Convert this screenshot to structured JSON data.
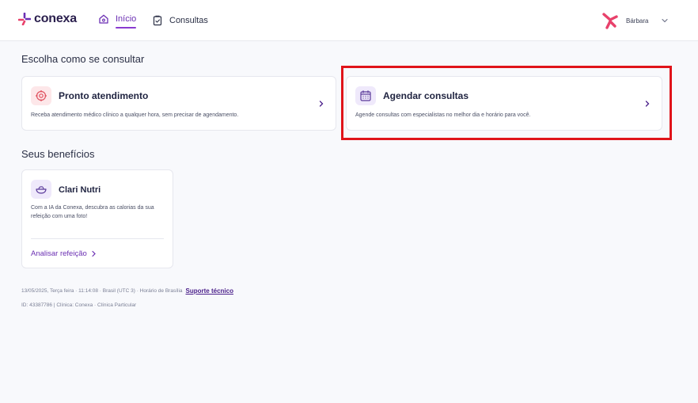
{
  "brand": {
    "name": "conexa",
    "accent": "#8a3ad0",
    "logo_colors": [
      "#e8416b",
      "#6b2fb3"
    ]
  },
  "nav": {
    "items": [
      {
        "label": "Início",
        "icon": "home-icon",
        "active": true
      },
      {
        "label": "Consultas",
        "icon": "clipboard-icon",
        "active": false
      }
    ]
  },
  "user": {
    "name": "Bárbara",
    "icon": "user-avatar-icon"
  },
  "main": {
    "choose_title": "Escolha como se consultar",
    "cards": [
      {
        "title": "Pronto atendimento",
        "description": "Receba atendimento médico clínico a qualquer hora, sem precisar de agendamento.",
        "icon": "target-icon"
      },
      {
        "title": "Agendar consultas",
        "description": "Agende consultas com especialistas no melhor dia e horário para você.",
        "icon": "calendar-icon"
      }
    ],
    "benefits_title": "Seus benefícios",
    "benefit": {
      "title": "Clari Nutri",
      "description": "Com a IA da Conexa, descubra as calorias da sua refeição com uma foto!",
      "link": "Analisar refeição",
      "icon": "bowl-icon"
    }
  },
  "footer": {
    "datetime": "13/05/2025, Terça feira · 11:14:08 · Brasil (UTC 3) · Horário de Brasília",
    "support": "Suporte técnico",
    "ids": "ID: 43387786 | Clínica: Conexa · Clínica Particular"
  },
  "highlight_color": "#e0141a"
}
